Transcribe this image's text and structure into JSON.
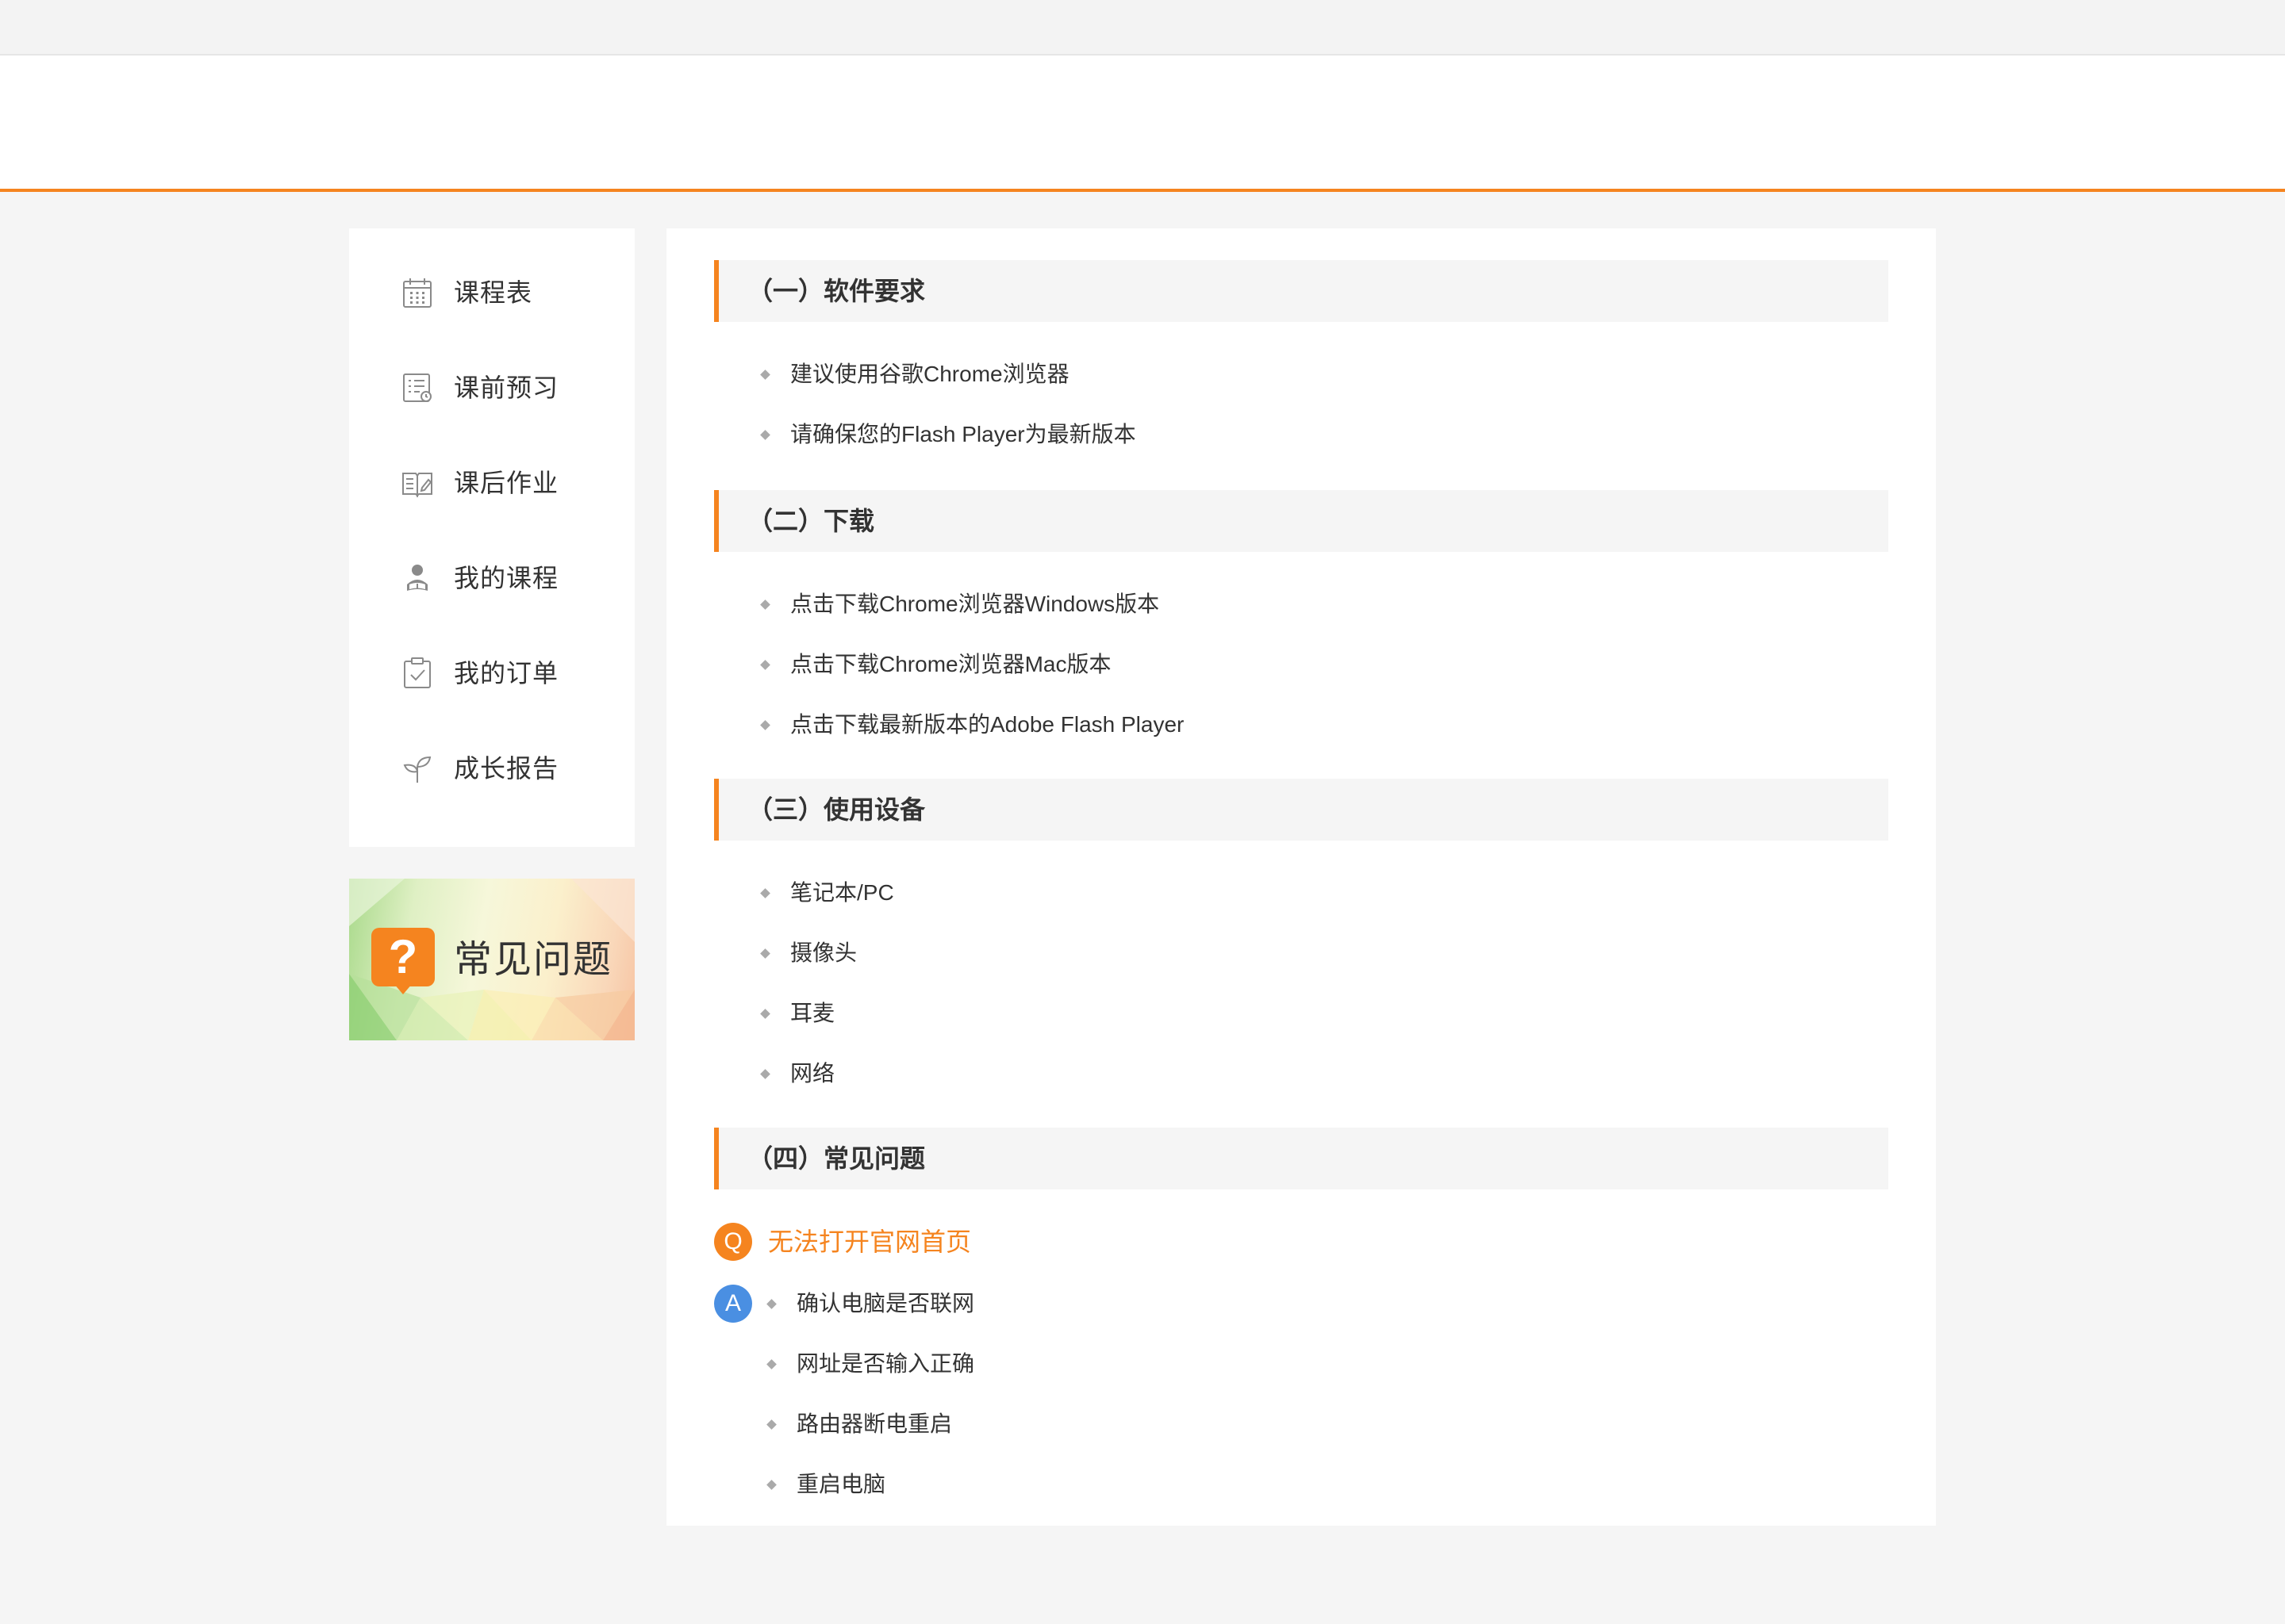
{
  "sidebar": {
    "items": [
      {
        "label": "课程表",
        "icon": "calendar-icon"
      },
      {
        "label": "课前预习",
        "icon": "checklist-icon"
      },
      {
        "label": "课后作业",
        "icon": "open-book-icon"
      },
      {
        "label": "我的课程",
        "icon": "student-icon"
      },
      {
        "label": "我的订单",
        "icon": "clipboard-check-icon"
      },
      {
        "label": "成长报告",
        "icon": "sprout-icon"
      }
    ]
  },
  "faq_banner": {
    "icon_text": "?",
    "title": "常见问题"
  },
  "sections": [
    {
      "title": "（一）软件要求",
      "items": [
        "建议使用谷歌Chrome浏览器",
        "请确保您的Flash Player为最新版本"
      ]
    },
    {
      "title": "（二）下载",
      "items": [
        "点击下载Chrome浏览器Windows版本",
        "点击下载Chrome浏览器Mac版本",
        "点击下载最新版本的Adobe Flash Player"
      ]
    },
    {
      "title": "（三）使用设备",
      "items": [
        "笔记本/PC",
        "摄像头",
        "耳麦",
        "网络"
      ]
    },
    {
      "title": "（四）常见问题"
    }
  ],
  "faq": {
    "q_badge": "Q",
    "a_badge": "A",
    "question": "无法打开官网首页",
    "answers": [
      "确认电脑是否联网",
      "网址是否输入正确",
      "路由器断电重启",
      "重启电脑"
    ]
  },
  "colors": {
    "accent": "#f5841f",
    "answer_badge": "#4a8fe2",
    "background": "#f5f5f5"
  }
}
